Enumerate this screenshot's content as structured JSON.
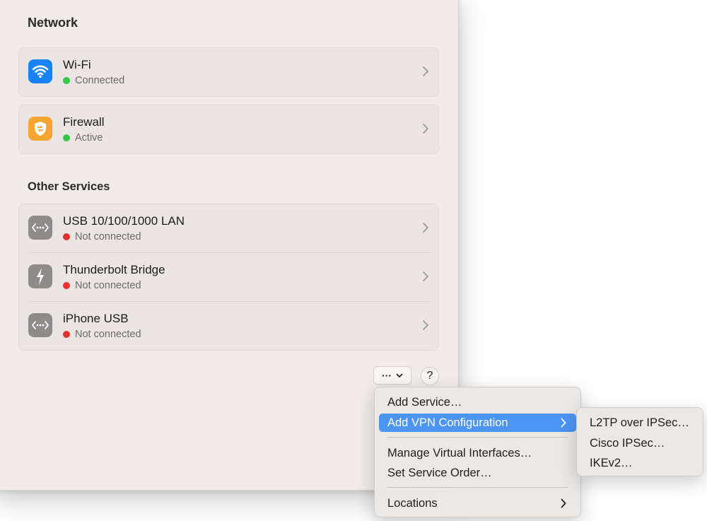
{
  "network": {
    "title": "Network",
    "services": [
      {
        "name": "Wi-Fi",
        "status": "Connected",
        "status_color": "#33c748",
        "icon": "wifi-icon"
      },
      {
        "name": "Firewall",
        "status": "Active",
        "status_color": "#33c748",
        "icon": "shield-icon"
      }
    ]
  },
  "other": {
    "title": "Other Services",
    "services": [
      {
        "name": "USB 10/100/1000 LAN",
        "status": "Not connected",
        "status_color": "#e8302a",
        "icon": "ethernet-icon"
      },
      {
        "name": "Thunderbolt Bridge",
        "status": "Not connected",
        "status_color": "#e8302a",
        "icon": "thunderbolt-icon"
      },
      {
        "name": "iPhone USB",
        "status": "Not connected",
        "status_color": "#e8302a",
        "icon": "ethernet-icon"
      }
    ]
  },
  "toolbar": {
    "more_label": "···",
    "help_label": "?"
  },
  "action_menu": {
    "items": [
      {
        "label": "Add Service…"
      },
      {
        "label": "Add VPN Configuration",
        "highlighted": true
      },
      {
        "label": "Manage Virtual Interfaces…"
      },
      {
        "label": "Set Service Order…"
      },
      {
        "label": "Locations"
      }
    ]
  },
  "vpn_submenu": {
    "items": [
      {
        "label": "L2TP over IPSec…"
      },
      {
        "label": "Cisco IPSec…"
      },
      {
        "label": "IKEv2…"
      }
    ]
  },
  "colors": {
    "wifi_icon_bg": "#1a82f7",
    "firewall_icon_bg": "#f7a531",
    "gray_icon_bg": "#8e8b8a",
    "menu_highlight": "#4c95f2"
  }
}
